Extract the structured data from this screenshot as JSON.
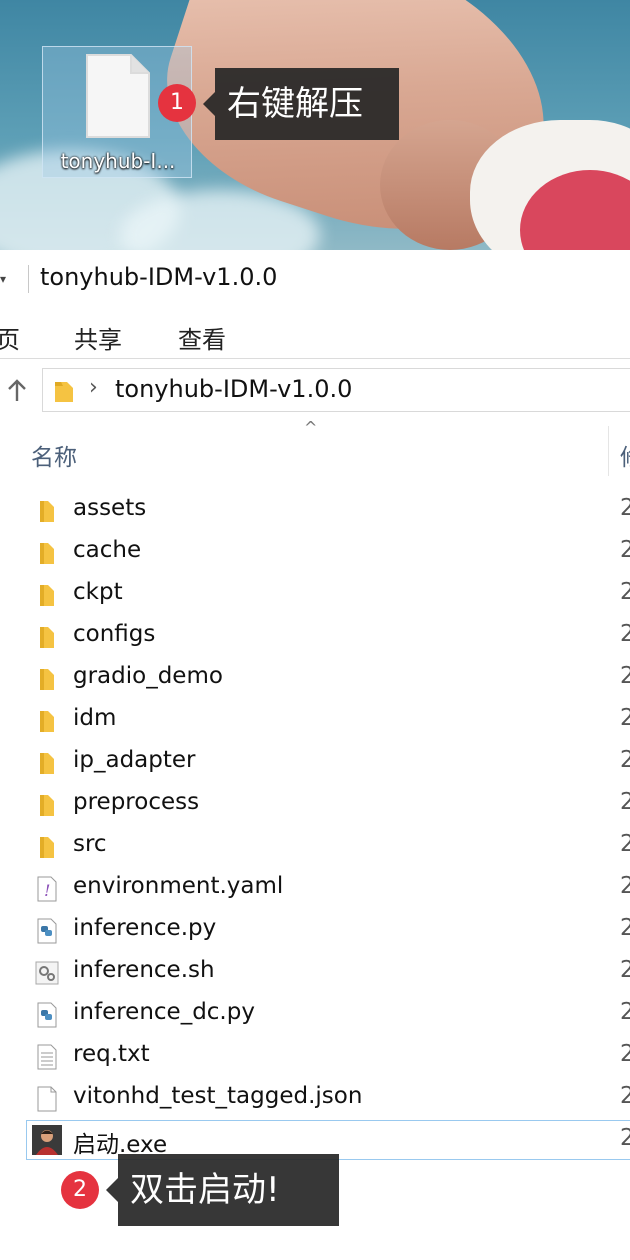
{
  "desktop": {
    "icon_label": "tonyhub-I...",
    "annotations": [
      {
        "number": "1",
        "text": "右键解压"
      },
      {
        "number": "2",
        "text": "双击启动!"
      }
    ],
    "badge_color": "#e5333f"
  },
  "explorer": {
    "title": "tonyhub-IDM-v1.0.0",
    "menu": [
      "页",
      "共享",
      "查看"
    ],
    "address_path": "tonyhub-IDM-v1.0.0",
    "columns": {
      "name": "名称",
      "next": "修"
    },
    "files": [
      {
        "name": "assets",
        "icon": "folder-icon",
        "date": "2"
      },
      {
        "name": "cache",
        "icon": "folder-icon",
        "date": "2"
      },
      {
        "name": "ckpt",
        "icon": "folder-icon",
        "date": "2"
      },
      {
        "name": "configs",
        "icon": "folder-icon",
        "date": "2"
      },
      {
        "name": "gradio_demo",
        "icon": "folder-icon",
        "date": "2"
      },
      {
        "name": "idm",
        "icon": "folder-icon",
        "date": "2"
      },
      {
        "name": "ip_adapter",
        "icon": "folder-icon",
        "date": "2"
      },
      {
        "name": "preprocess",
        "icon": "folder-icon",
        "date": "2"
      },
      {
        "name": "src",
        "icon": "folder-icon",
        "date": "2"
      },
      {
        "name": "environment.yaml",
        "icon": "yaml-file-icon",
        "date": "2"
      },
      {
        "name": "inference.py",
        "icon": "python-file-icon",
        "date": "2"
      },
      {
        "name": "inference.sh",
        "icon": "shell-script-icon",
        "date": "2"
      },
      {
        "name": "inference_dc.py",
        "icon": "python-file-icon",
        "date": "2"
      },
      {
        "name": "req.txt",
        "icon": "text-file-icon",
        "date": "2"
      },
      {
        "name": "vitonhd_test_tagged.json",
        "icon": "blank-file-icon",
        "date": "2"
      },
      {
        "name": "启动.exe",
        "icon": "exe-app-icon",
        "date": "2"
      }
    ],
    "folder_color": "#f5c342",
    "selection_border_color": "#99c9ef"
  }
}
